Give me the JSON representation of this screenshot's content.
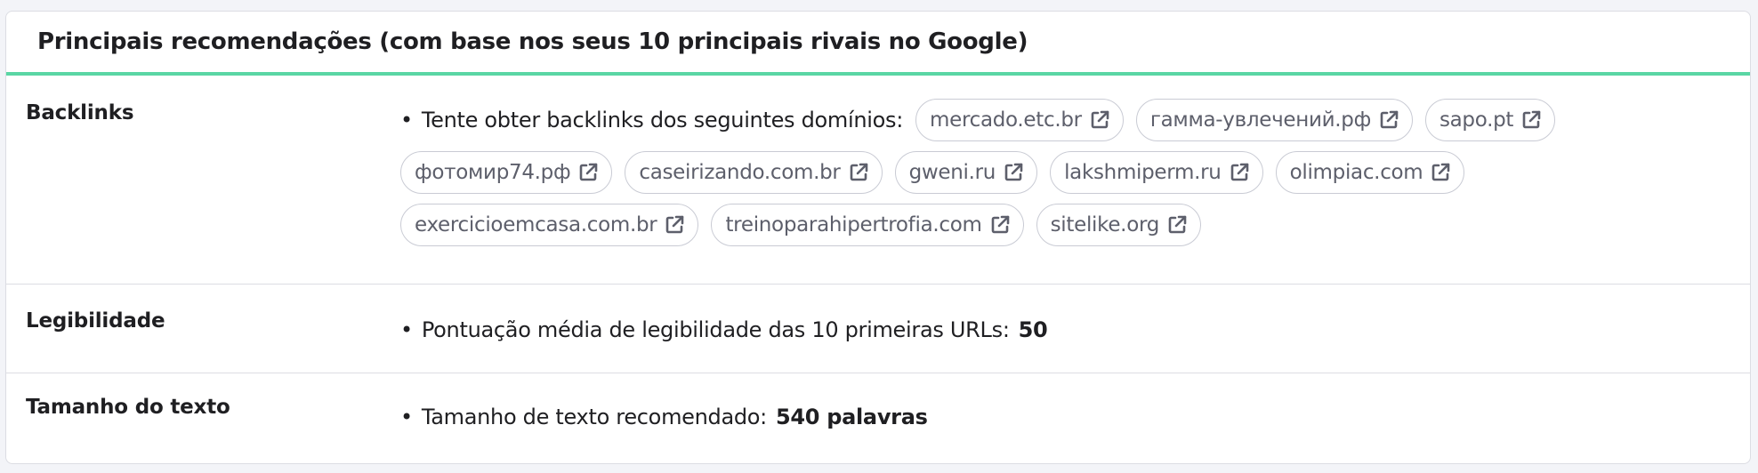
{
  "header": {
    "title": "Principais recomendações (com base nos seus 10 principais rivais no Google)"
  },
  "rows": {
    "backlinks": {
      "label": "Backlinks",
      "text": "Tente obter backlinks dos seguintes domínios:",
      "domains": [
        "mercado.etc.br",
        "гамма-увлечений.рф",
        "sapo.pt",
        "фотомир74.рф",
        "caseirizando.com.br",
        "gweni.ru",
        "lakshmiperm.ru",
        "olimpiac.com",
        "exercicioemcasa.com.br",
        "treinoparahipertrofia.com",
        "sitelike.org"
      ]
    },
    "readability": {
      "label": "Legibilidade",
      "text": "Pontuação média de legibilidade das 10 primeiras URLs:",
      "value": "50"
    },
    "text_size": {
      "label": "Tamanho do texto",
      "text": "Tamanho de texto recomendado:",
      "value": "540 palavras"
    }
  },
  "bullet": "•",
  "icons": {
    "domain_link": "external-link-icon"
  },
  "colors": {
    "accent_border": "#5ad6a4",
    "chip_text": "#5d5f6b",
    "chip_border": "#c9cbd4"
  }
}
